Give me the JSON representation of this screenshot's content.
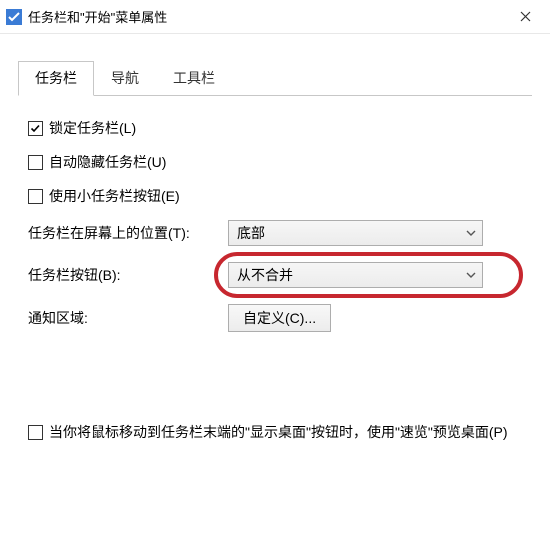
{
  "window": {
    "title": "任务栏和\"开始\"菜单属性"
  },
  "tabs": {
    "items": [
      "任务栏",
      "导航",
      "工具栏"
    ],
    "active_index": 0
  },
  "checkboxes": {
    "lock": {
      "label": "锁定任务栏(L)",
      "checked": true
    },
    "autohide": {
      "label": "自动隐藏任务栏(U)",
      "checked": false
    },
    "smallbtn": {
      "label": "使用小任务栏按钮(E)",
      "checked": false
    },
    "peek": {
      "label": "当你将鼠标移动到任务栏末端的\"显示桌面\"按钮时，使用\"速览\"预览桌面(P)",
      "checked": false
    }
  },
  "position": {
    "label": "任务栏在屏幕上的位置(T):",
    "value": "底部"
  },
  "buttons_combine": {
    "label": "任务栏按钮(B):",
    "value": "从不合并"
  },
  "notification": {
    "label": "通知区域:",
    "button": "自定义(C)..."
  }
}
